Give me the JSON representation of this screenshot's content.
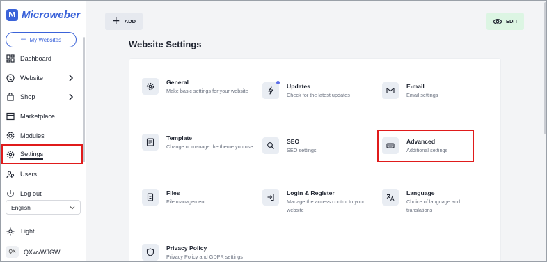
{
  "app": {
    "logo_text": "Microweber",
    "logo_mark": "M",
    "brand_color": "#3b63d9"
  },
  "sidebar": {
    "my_websites": "My Websites",
    "items": [
      {
        "label": "Dashboard",
        "icon": "dashboard-icon"
      },
      {
        "label": "Website",
        "icon": "globe-icon",
        "has_chevron": true
      },
      {
        "label": "Shop",
        "icon": "shopping-bag-icon",
        "has_chevron": true
      },
      {
        "label": "Marketplace",
        "icon": "store-icon"
      },
      {
        "label": "Modules",
        "icon": "modules-icon"
      },
      {
        "label": "Settings",
        "icon": "gear-icon",
        "active": true
      },
      {
        "label": "Users",
        "icon": "users-icon"
      },
      {
        "label": "Log out",
        "icon": "logout-icon"
      }
    ],
    "language": "English",
    "theme": "Light",
    "user": {
      "initials": "QX",
      "name": "QXwvWJGW"
    }
  },
  "toolbar": {
    "add_label": "ADD",
    "edit_label": "EDIT"
  },
  "page": {
    "title": "Website Settings"
  },
  "settings": [
    {
      "title": "General",
      "desc": "Make basic settings for your website",
      "icon": "gear-icon"
    },
    {
      "title": "Updates",
      "desc": "Check for the latest updates",
      "icon": "bolt-icon",
      "badge": true
    },
    {
      "title": "E-mail",
      "desc": "Email settings",
      "icon": "mail-icon"
    },
    {
      "title": "Template",
      "desc": "Change or manage the theme you use",
      "icon": "template-icon"
    },
    {
      "title": "SEO",
      "desc": "SEO settings",
      "icon": "search-icon"
    },
    {
      "title": "Advanced",
      "desc": "Additional settings",
      "icon": "keyboard-icon",
      "highlighted": true
    },
    {
      "title": "Files",
      "desc": "File management",
      "icon": "file-icon"
    },
    {
      "title": "Login & Register",
      "desc": "Manage the access control to your website",
      "icon": "login-icon"
    },
    {
      "title": "Language",
      "desc": "Choice of language and translations",
      "icon": "translate-icon"
    },
    {
      "title": "Privacy Policy",
      "desc": "Privacy Policy and GDPR settings",
      "icon": "shield-icon"
    }
  ],
  "colors": {
    "highlight": "#e01b1b",
    "edit_bg": "#dcf5e3",
    "badge": "#5b6ee8"
  }
}
